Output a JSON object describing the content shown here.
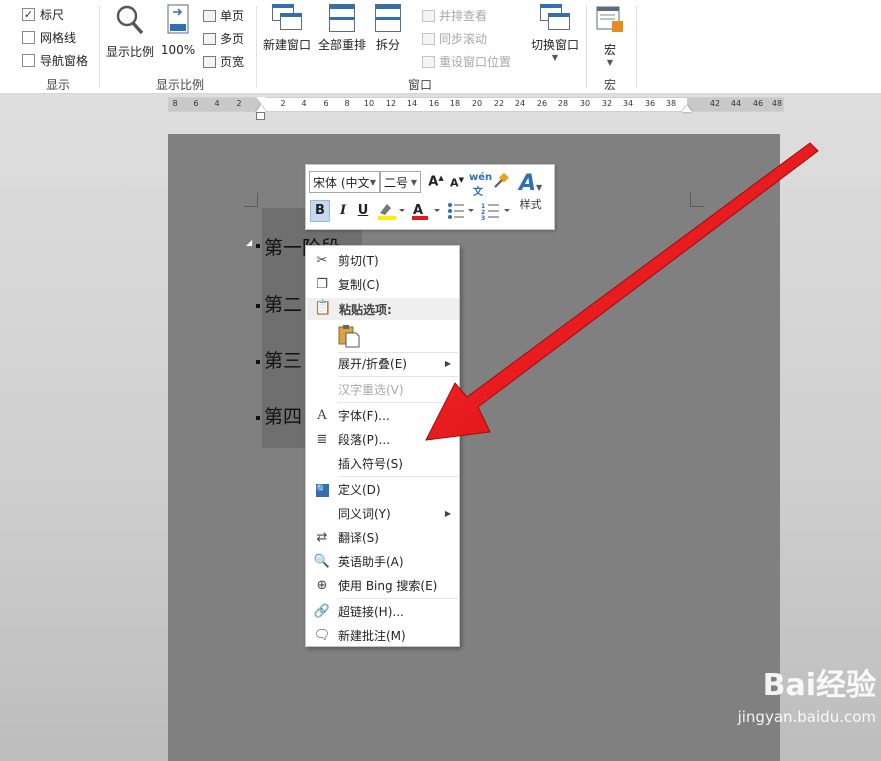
{
  "ribbon": {
    "show_group": {
      "label": "显示",
      "items": [
        {
          "label": "标尺",
          "checked": true
        },
        {
          "label": "网格线",
          "checked": false
        },
        {
          "label": "导航窗格",
          "checked": false
        }
      ]
    },
    "zoom_group": {
      "label": "显示比例",
      "zoom_button": "显示比例",
      "hundred_button": "100%",
      "single_page": "单页",
      "multi_page": "多页",
      "page_width": "页宽"
    },
    "window_group": {
      "label": "窗口",
      "new_window": "新建窗口",
      "arrange_all": "全部重排",
      "split": "拆分",
      "side_by_side": "并排查看",
      "sync_scroll": "同步滚动",
      "reset_position": "重设窗口位置",
      "switch_window": "切换窗口"
    },
    "macro_group": {
      "label": "宏",
      "macro_button": "宏"
    }
  },
  "ruler": {
    "ticks": [
      "8",
      "6",
      "4",
      "2",
      "2",
      "4",
      "6",
      "8",
      "10",
      "12",
      "14",
      "16",
      "18",
      "20",
      "22",
      "24",
      "26",
      "28",
      "30",
      "32",
      "34",
      "36",
      "38",
      "42",
      "44",
      "46",
      "48"
    ]
  },
  "document": {
    "headings": [
      "第一阶段",
      "第二",
      "第三",
      "第四"
    ]
  },
  "mini_toolbar": {
    "font": "宋体 (中文",
    "size": "二号",
    "styles_label": "样式",
    "bold": "B",
    "italic": "I",
    "underline": "U"
  },
  "context_menu": {
    "cut": "剪切(T)",
    "copy": "复制(C)",
    "paste_header": "粘贴选项:",
    "expand_collapse": "展开/折叠(E)",
    "reconvert": "汉字重选(V)",
    "font": "字体(F)...",
    "paragraph": "段落(P)...",
    "insert_symbol": "插入符号(S)",
    "define": "定义(D)",
    "synonyms": "同义词(Y)",
    "translate": "翻译(S)",
    "english_assistant": "英语助手(A)",
    "bing_search": "使用 Bing 搜索(E)",
    "hyperlink": "超链接(H)...",
    "new_comment": "新建批注(M)"
  },
  "watermark": {
    "logo": "Bai经验",
    "url": "jingyan.baidu.com"
  },
  "colors": {
    "accent_blue": "#2e6fb5",
    "arrow_red": "#e8161b",
    "page_grey": "#808080"
  }
}
